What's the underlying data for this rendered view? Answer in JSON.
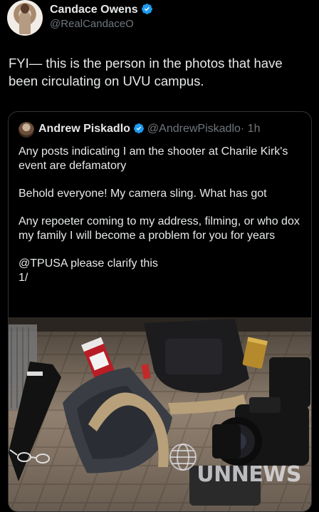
{
  "tweet": {
    "author_name": "Candace Owens",
    "author_handle": "@RealCandaceO",
    "text": "FYI— this is the person in the photos that have been circulating on UVU campus."
  },
  "quoted_tweet": {
    "author_name": "Andrew Piskadlo",
    "author_handle": "@AndrewPiskadlo",
    "time": "· 1h",
    "paragraphs": [
      "Any posts indicating I am the shooter at Charile Kirk's event are defamatory",
      "Behold everyone! My camera sling. What has got",
      "Any repoeter coming to my address, filming, or who dox my family I will become a problem for you for years",
      "@TPUSA please clarify this\n1/"
    ]
  },
  "media": {
    "description_icon": "photo-of-camera-bag",
    "watermark": "UNNEWS"
  },
  "colors": {
    "background": "#000000",
    "text_primary": "#e7e9ea",
    "text_secondary": "#71767b",
    "verified_blue": "#1d9bf0",
    "border": "#2f3336"
  }
}
